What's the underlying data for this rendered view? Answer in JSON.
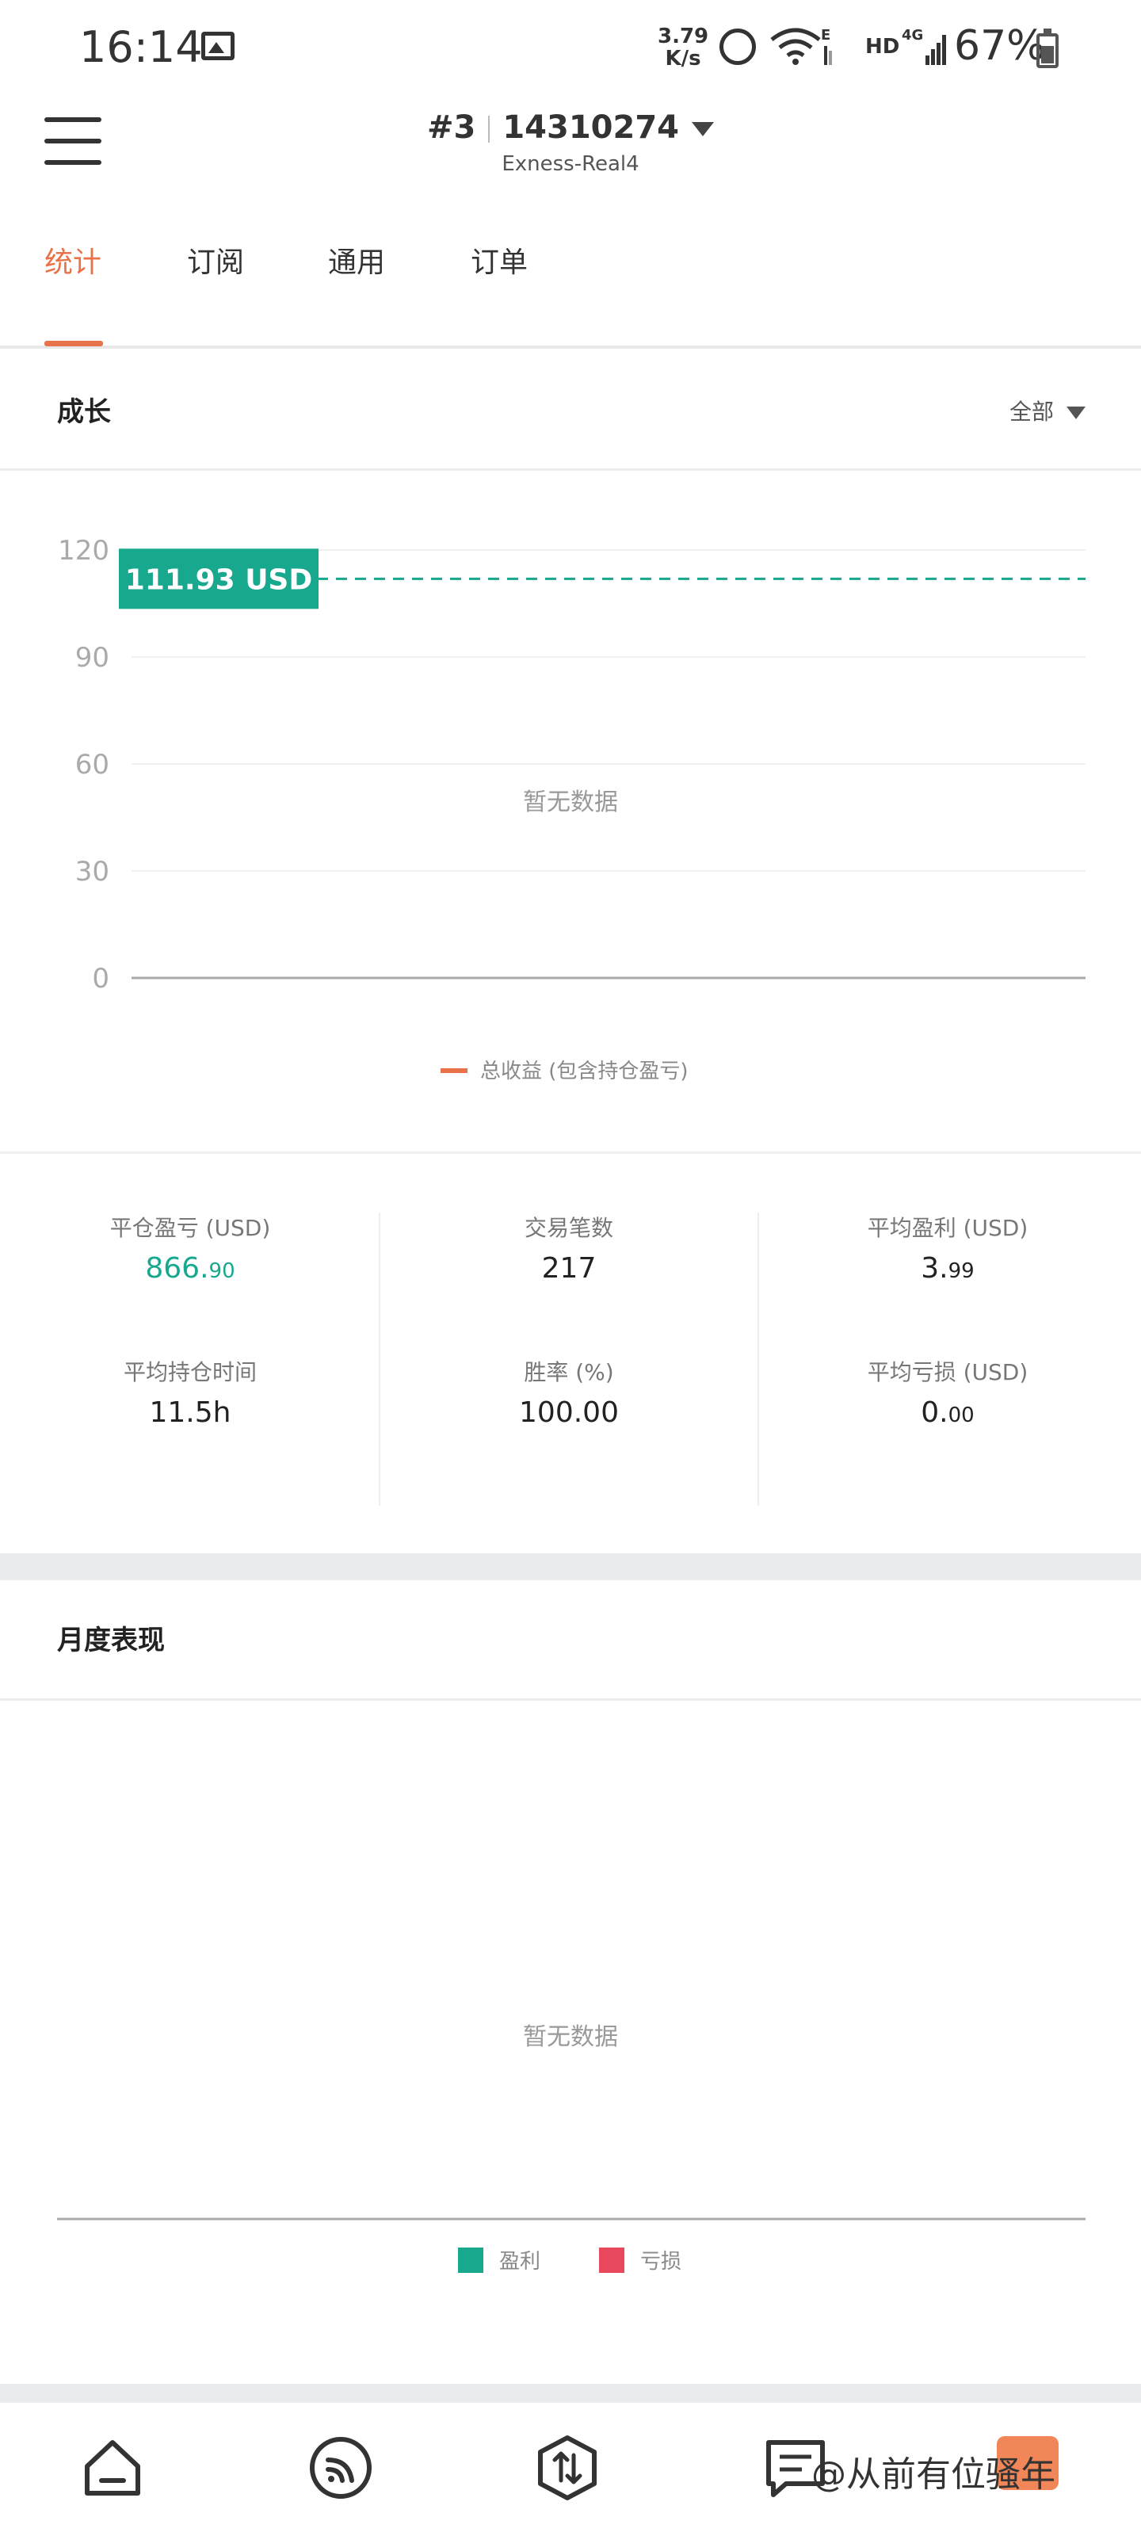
{
  "status_bar": {
    "time": "16:14",
    "net_speed_value": "3.79",
    "net_speed_unit": "K/s",
    "hd_label": "HD",
    "network_type": "4G",
    "wifi_badge": "E",
    "battery_pct": "67%"
  },
  "header": {
    "account_index": "#3",
    "account_number": "14310274",
    "server": "Exness-Real4"
  },
  "tabs": [
    {
      "label": "统计",
      "active": true
    },
    {
      "label": "订阅",
      "active": false
    },
    {
      "label": "通用",
      "active": false
    },
    {
      "label": "订单",
      "active": false
    }
  ],
  "growth": {
    "title": "成长",
    "filter_label": "全部",
    "empty_text": "暂无数据",
    "legend_label": "总收益 (包含持仓盈亏)",
    "current_value_badge": "111.93 USD"
  },
  "chart_data": {
    "type": "line",
    "title": "成长",
    "y_ticks": [
      "120",
      "90",
      "60",
      "30",
      "0"
    ],
    "ylim": [
      0,
      120
    ],
    "reference_line": {
      "value": 111.93,
      "label": "111.93 USD",
      "style": "dashed",
      "color": "#17a88e"
    },
    "series": [
      {
        "name": "总收益 (包含持仓盈亏)",
        "color": "#e8734a",
        "values": []
      }
    ],
    "grid": true,
    "legend_position": "bottom-center"
  },
  "stats": [
    {
      "label": "平仓盈亏 (USD)",
      "int": "866.",
      "dec": "90",
      "green": true
    },
    {
      "label": "交易笔数",
      "int": "217",
      "dec": "",
      "green": false
    },
    {
      "label": "平均盈利 (USD)",
      "int": "3.",
      "dec": "99",
      "green": false
    },
    {
      "label": "平均持仓时间",
      "int": "11.5h",
      "dec": "",
      "green": false
    },
    {
      "label": "胜率 (%)",
      "int": "100.00",
      "dec": "",
      "green": false
    },
    {
      "label": "平均亏损 (USD)",
      "int": "0.",
      "dec": "00",
      "green": false
    }
  ],
  "monthly": {
    "title": "月度表现",
    "empty_text": "暂无数据",
    "legend_profit": "盈利",
    "legend_loss": "亏损",
    "profit_color": "#17a88e",
    "loss_color": "#e8485c"
  },
  "watermark": "@从前有位骚年",
  "colors": {
    "accent": "#e8734a",
    "green": "#17a88e"
  }
}
